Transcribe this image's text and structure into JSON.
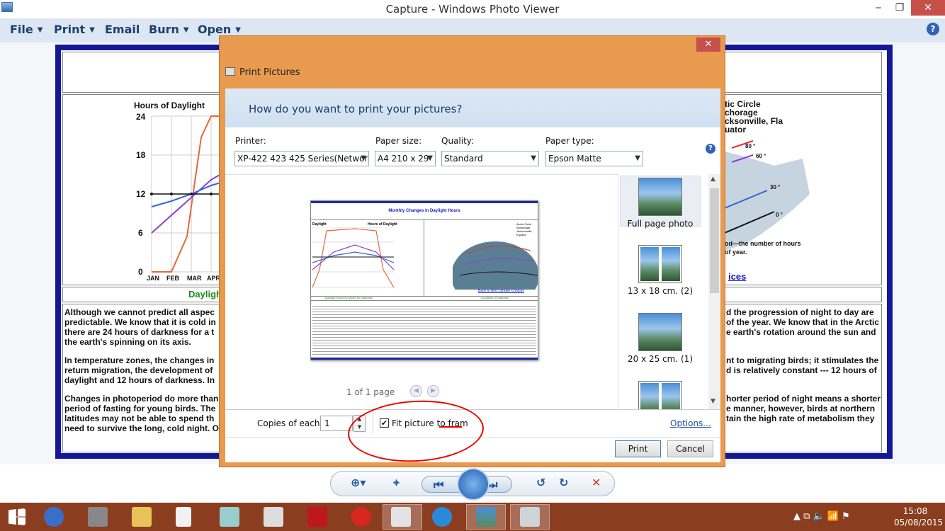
{
  "window": {
    "title": "Capture - Windows Photo Viewer",
    "minimize": "‒",
    "maximize": "❐",
    "close": "✕"
  },
  "menu": {
    "items": [
      "File",
      "Print",
      "Email",
      "Burn",
      "Open"
    ],
    "caret": "▼",
    "help": "?"
  },
  "background_doc": {
    "chart_title": "Hours of Daylight",
    "y_ticks": [
      "24",
      "18",
      "12",
      "6",
      "0"
    ],
    "x_ticks": [
      "JAN",
      "FEB",
      "MAR",
      "APR"
    ],
    "caption": "Daylight",
    "legend": [
      "tic Circle",
      "chorage",
      "cksonville, Fla",
      "uator"
    ],
    "lat_labels": [
      "80 °",
      "60 °",
      "30 °",
      "0 °"
    ],
    "map_note_1": "od—the number of hours",
    "map_note_2": "of year.",
    "link_fragment": "ices",
    "left_para_1": [
      "Although we cannot predict all aspec",
      "predictable. We know that it is cold in",
      "there are 24 hours of darkness for a t",
      "the earth's spinning on its axis."
    ],
    "right_para_1": [
      "d the progression of night to day are",
      "of the year. We know that in the Arctic",
      "e earth's rotation around the sun and"
    ],
    "left_para_2": [
      "In temperature zones, the changes in",
      "return migration, the development of",
      "daylight and 12 hours of darkness. In"
    ],
    "right_para_2": [
      "nt to migrating birds; it stimulates the",
      "d is relatively constant --- 12 hours of"
    ],
    "left_para_3": [
      "Changes in photoperiod do more than",
      "period of fasting for young birds. The",
      "latitudes may not be able to spend th",
      "need to survive the long, cold night. O"
    ],
    "right_para_3": [
      "horter period of night means a shorter",
      "e manner, however, birds at northern",
      "tain the high rate of metabolism they"
    ]
  },
  "dialog": {
    "title": "Print Pictures",
    "close": "✕",
    "question": "How do you want to print your pictures?",
    "printer": {
      "label": "Printer:",
      "value": "XP-422 423 425 Series(Networ"
    },
    "paper_size": {
      "label": "Paper size:",
      "value": "A4 210 x 29"
    },
    "quality": {
      "label": "Quality:",
      "value": "Standard"
    },
    "paper_type": {
      "label": "Paper type:",
      "value": "Epson Matte"
    },
    "help": "?",
    "preview": {
      "page_title": "Monthly Changes in Daylight Hours",
      "chart_left": "Daylight",
      "chart_right": "Hours of Daylight",
      "legend": [
        "Arctic Circle",
        "Anchorage",
        "Jacksonville,",
        "Equator"
      ],
      "link": "Back to Bird Climate Choices",
      "band_left": "Daylight Hours by Month for Latitudes",
      "band_right": "Locations of Latitudes"
    },
    "page_info": "1 of 1 page",
    "prev": "◀",
    "next": "▶",
    "layouts": [
      {
        "label": "Full page photo",
        "selected": true
      },
      {
        "label": "13 x 18 cm. (2)",
        "selected": false
      },
      {
        "label": "20 x 25 cm. (1)",
        "selected": false
      },
      {
        "label": "",
        "selected": false
      }
    ],
    "copies_label": "Copies of each",
    "copies_value": "1",
    "fit_label": "Fit picture to fram",
    "fit_checked": "✔",
    "options_link": "Options...",
    "print_button": "Print",
    "cancel_button": "Cancel"
  },
  "taskbar": {
    "time": "15:08",
    "date": "05/08/2015",
    "tray": "▲  ⧉  🔈  📶  ⚑"
  }
}
